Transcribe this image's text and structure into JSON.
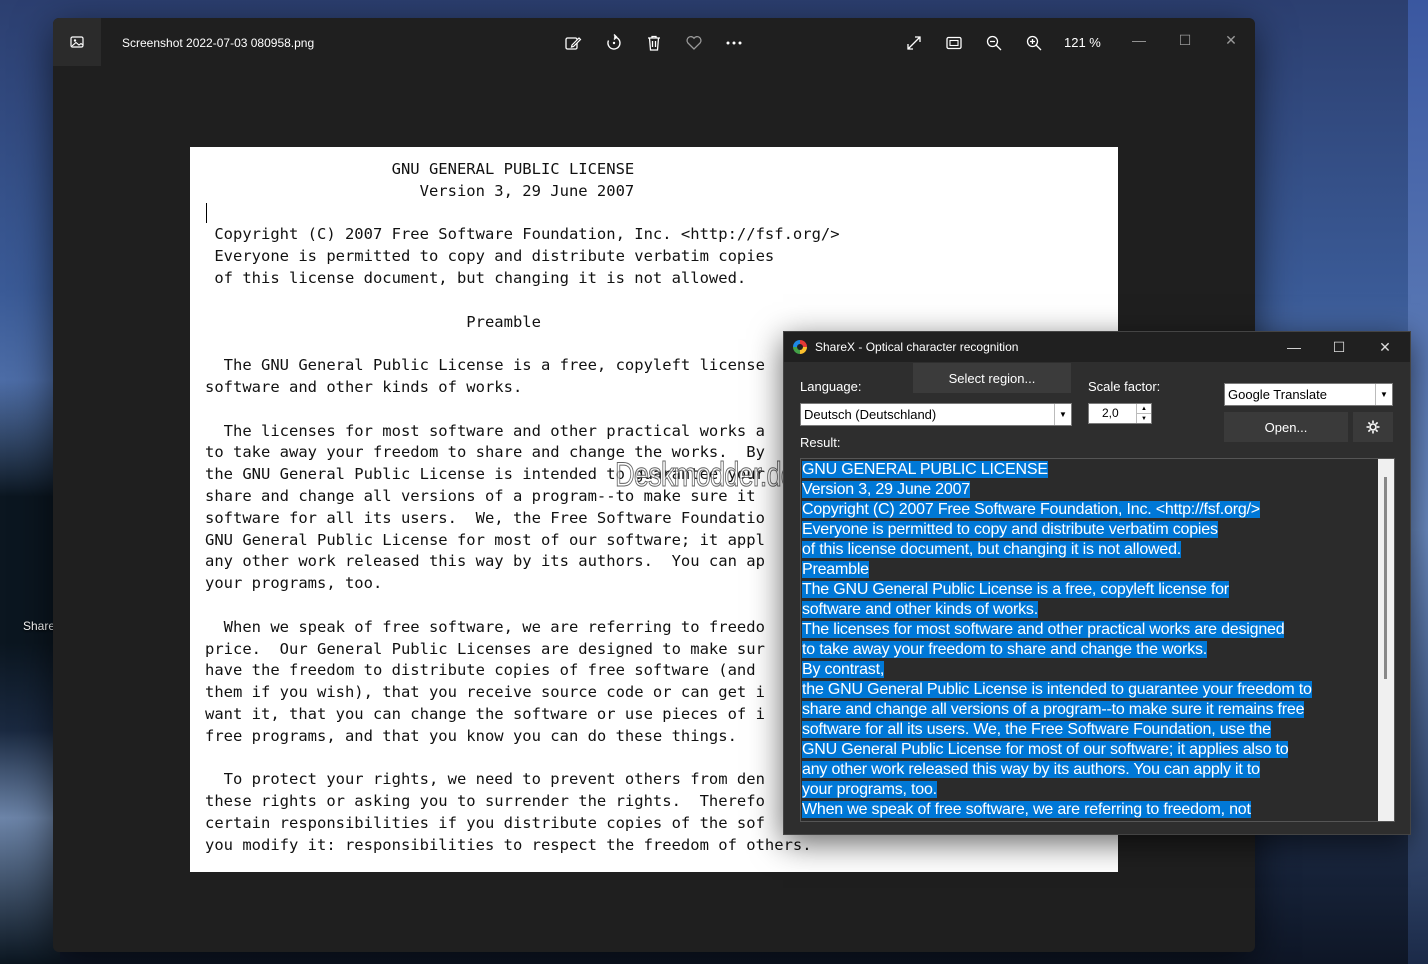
{
  "desktop": {
    "label": "Share"
  },
  "viewer": {
    "title": "Screenshot 2022-07-03 080958.png",
    "zoom": "121 %",
    "toolbar_icons": [
      "edit-icon",
      "rotate-icon",
      "delete-icon",
      "favorite-icon",
      "more-icon"
    ],
    "view_icons": [
      "fullscreen-icon",
      "fit-icon",
      "zoom-out-icon",
      "zoom-in-icon"
    ],
    "controls": {
      "minimize": "—",
      "maximize": "☐",
      "close": "✕"
    }
  },
  "document": {
    "lines": [
      "                    GNU GENERAL PUBLIC LICENSE",
      "                       Version 3, 29 June 2007",
      "",
      " Copyright (C) 2007 Free Software Foundation, Inc. <http://fsf.org/>",
      " Everyone is permitted to copy and distribute verbatim copies",
      " of this license document, but changing it is not allowed.",
      "",
      "                            Preamble",
      "",
      "  The GNU General Public License is a free, copyleft license",
      "software and other kinds of works.",
      "",
      "  The licenses for most software and other practical works a",
      "to take away your freedom to share and change the works.  By",
      "the GNU General Public License is intended to guarantee your",
      "share and change all versions of a program--to make sure it",
      "software for all its users.  We, the Free Software Foundatio",
      "GNU General Public License for most of our software; it appl",
      "any other work released this way by its authors.  You can ap",
      "your programs, too.",
      "",
      "  When we speak of free software, we are referring to freedo",
      "price.  Our General Public Licenses are designed to make sur",
      "have the freedom to distribute copies of free software (and",
      "them if you wish), that you receive source code or can get i",
      "want it, that you can change the software or use pieces of i",
      "free programs, and that you know you can do these things.",
      "",
      "  To protect your rights, we need to prevent others from den",
      "these rights or asking you to surrender the rights.  Therefo",
      "certain responsibilities if you distribute copies of the sof",
      "you modify it: responsibilities to respect the freedom of others."
    ],
    "watermark": "Deskmodder.de"
  },
  "ocr": {
    "title": "ShareX - Optical character recognition",
    "controls": {
      "minimize": "—",
      "maximize": "☐",
      "close": "✕"
    },
    "language_label": "Language:",
    "language_value": "Deutsch (Deutschland)",
    "select_region": "Select region...",
    "scale_label": "Scale factor:",
    "scale_value": "2,0",
    "service_value": "Google Translate",
    "open_button": "Open...",
    "settings_icon": "gear-icon",
    "result_label": "Result:",
    "result_lines": [
      "GNU GENERAL PUBLIC LICENSE",
      "Version 3, 29 June 2007",
      "Copyright (C) 2007 Free Software Foundation, Inc. <http://fsf.org/>",
      "Everyone is permitted to copy and distribute verbatim copies",
      "of this license document, but changing it is not allowed.",
      "Preamble",
      "The GNU General Public License is a free, copyleft license for",
      "software and other kinds of works.",
      "The licenses for most software and other practical works are designed",
      "to take away your freedom to share and change the works.",
      "By contrast,",
      "the GNU General Public License is intended to guarantee your freedom to",
      "share and change all versions of a program--to make sure it remains free",
      "software for all its users. We, the Free Software Foundation, use the",
      "GNU General Public License for most of our software; it applies also to",
      "any other work released this way by its authors. You can apply it to",
      "your programs, too.",
      "When we speak of free software, we are referring to freedom, not"
    ]
  }
}
